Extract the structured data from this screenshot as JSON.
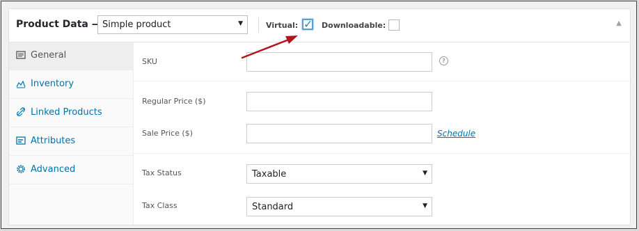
{
  "header": {
    "title": "Product Data —",
    "product_type": "Simple product",
    "virtual_label": "Virtual:",
    "virtual_checked": true,
    "downloadable_label": "Downloadable:",
    "downloadable_checked": false
  },
  "sidebar": {
    "tabs": [
      {
        "label": "General",
        "icon": "wrench-icon",
        "active": true
      },
      {
        "label": "Inventory",
        "icon": "chart-icon",
        "active": false
      },
      {
        "label": "Linked Products",
        "icon": "link-icon",
        "active": false
      },
      {
        "label": "Attributes",
        "icon": "list-icon",
        "active": false
      },
      {
        "label": "Advanced",
        "icon": "gear-icon",
        "active": false
      }
    ]
  },
  "fields": {
    "sku": {
      "label": "SKU",
      "value": "",
      "help": "?"
    },
    "regular_price": {
      "label": "Regular Price ($)",
      "value": ""
    },
    "sale_price": {
      "label": "Sale Price ($)",
      "value": "",
      "schedule_link": "Schedule"
    },
    "tax_status": {
      "label": "Tax Status",
      "value": "Taxable"
    },
    "tax_class": {
      "label": "Tax Class",
      "value": "Standard"
    }
  },
  "colors": {
    "link": "#0073aa",
    "annotation_arrow": "#b0161e",
    "checkbox_focus": "#5b9dd9"
  }
}
